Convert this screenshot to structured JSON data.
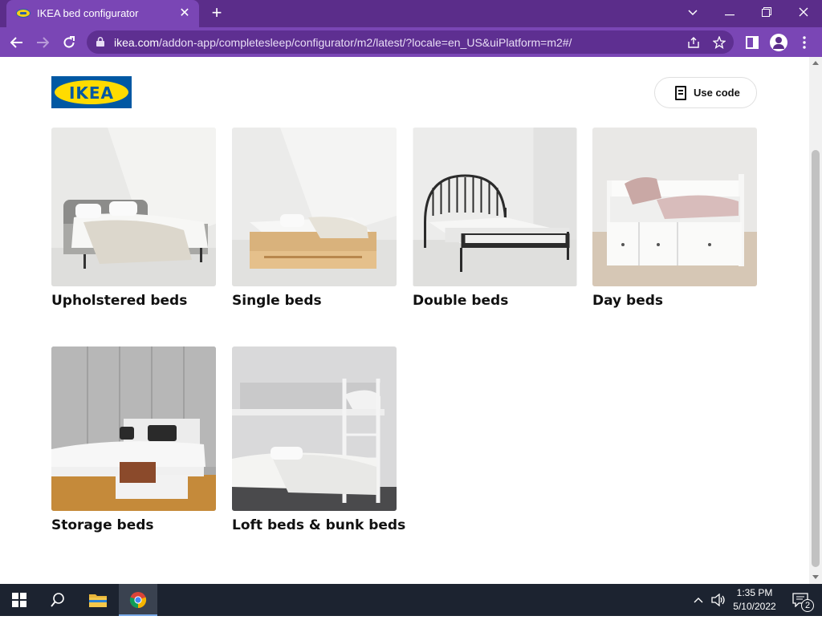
{
  "browser": {
    "tab_title": "IKEA bed configurator",
    "url_host": "ikea.com",
    "url_path": "/addon-app/completesleep/configurator/m2/latest/?locale=en_US&uiPlatform=m2#/"
  },
  "header": {
    "logo_text": "IKEA",
    "use_code_label": "Use code"
  },
  "categories": [
    {
      "label": "Upholstered beds"
    },
    {
      "label": "Single beds"
    },
    {
      "label": "Double beds"
    },
    {
      "label": "Day beds"
    },
    {
      "label": "Storage beds"
    },
    {
      "label": "Loft beds & bunk beds"
    }
  ],
  "taskbar": {
    "time": "1:35 PM",
    "date": "5/10/2022",
    "notification_count": "2"
  },
  "colors": {
    "chrome_dark": "#5b2d8a",
    "chrome_light": "#7a46b5",
    "ikea_blue": "#0058a3",
    "ikea_yellow": "#ffdb00"
  }
}
